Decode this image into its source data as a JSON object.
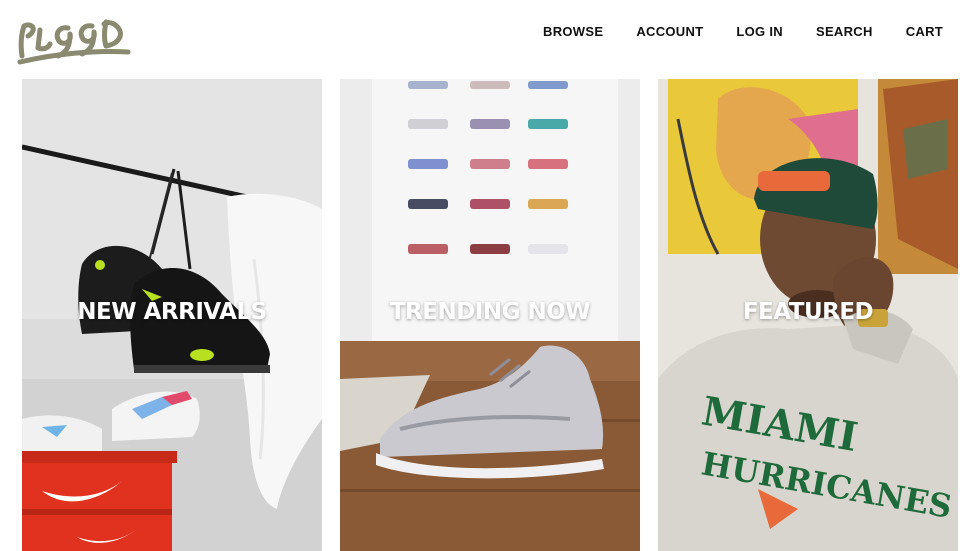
{
  "brand": {
    "logo_text": "PIGGD"
  },
  "nav": {
    "items": [
      {
        "label": "BROWSE"
      },
      {
        "label": "ACCOUNT"
      },
      {
        "label": "LOG IN"
      },
      {
        "label": "SEARCH"
      },
      {
        "label": "CART"
      }
    ]
  },
  "tiles": [
    {
      "label": "NEW ARRIVALS"
    },
    {
      "label": "TRENDING NOW"
    },
    {
      "label": "FEATURED"
    }
  ],
  "colors": {
    "logo": "#8a8a70",
    "label": "#ffffff",
    "nav_text": "#111111"
  }
}
